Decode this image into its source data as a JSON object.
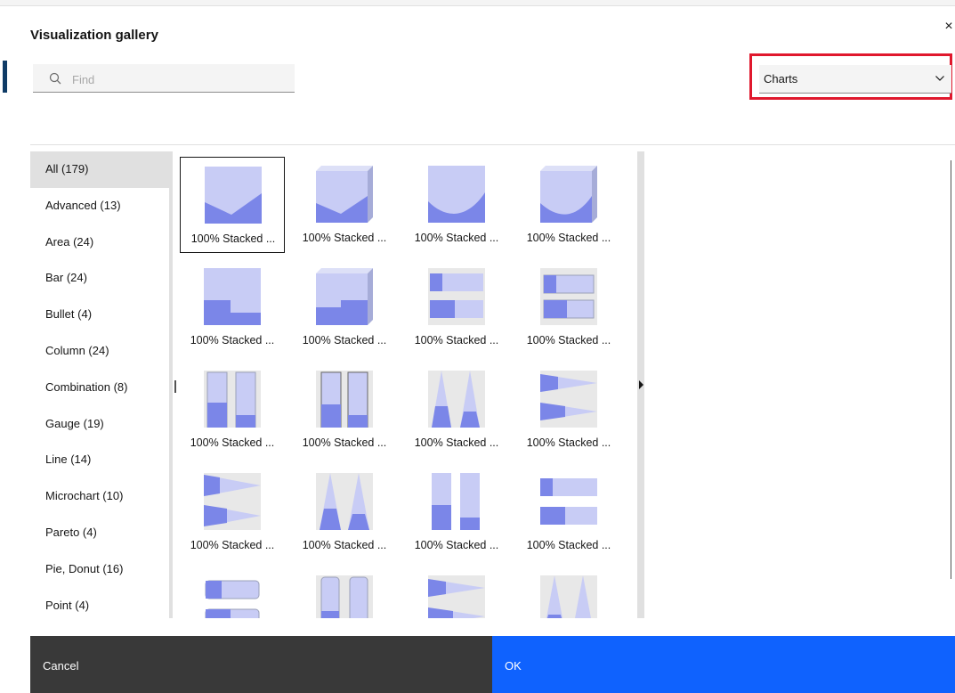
{
  "dialog": {
    "title": "Visualization gallery",
    "close_glyph": "×"
  },
  "search": {
    "placeholder": "Find",
    "value": ""
  },
  "type_select": {
    "value": "Charts"
  },
  "categories": [
    {
      "label": "All (179)",
      "active": true
    },
    {
      "label": "Advanced (13)"
    },
    {
      "label": "Area (24)"
    },
    {
      "label": "Bar (24)"
    },
    {
      "label": "Bullet (4)"
    },
    {
      "label": "Column (24)"
    },
    {
      "label": "Combination (8)"
    },
    {
      "label": "Gauge (19)"
    },
    {
      "label": "Line (14)"
    },
    {
      "label": "Microchart (10)"
    },
    {
      "label": "Pareto (4)"
    },
    {
      "label": "Pie, Donut (16)"
    },
    {
      "label": "Point (4)"
    }
  ],
  "gallery": [
    {
      "label": "100% Stacked ...",
      "icon": "area-stacked-icon",
      "selected": true
    },
    {
      "label": "100% Stacked ...",
      "icon": "area-stacked-3d-icon"
    },
    {
      "label": "100% Stacked ...",
      "icon": "area-smooth-icon"
    },
    {
      "label": "100% Stacked ...",
      "icon": "area-smooth-3d-icon"
    },
    {
      "label": "100% Stacked ...",
      "icon": "area-step-icon"
    },
    {
      "label": "100% Stacked ...",
      "icon": "area-step-3d-icon"
    },
    {
      "label": "100% Stacked ...",
      "icon": "bar-stacked-icon"
    },
    {
      "label": "100% Stacked ...",
      "icon": "bar-stacked-3d-icon"
    },
    {
      "label": "100% Stacked ...",
      "icon": "column-stacked-icon"
    },
    {
      "label": "100% Stacked ...",
      "icon": "column-stacked-3d-icon"
    },
    {
      "label": "100% Stacked ...",
      "icon": "cone-column-icon"
    },
    {
      "label": "100% Stacked ...",
      "icon": "cone-bar-icon"
    },
    {
      "label": "100% Stacked ...",
      "icon": "cone-bar-3d-icon"
    },
    {
      "label": "100% Stacked ...",
      "icon": "cone-column-3d-icon"
    },
    {
      "label": "100% Stacked ...",
      "icon": "cylinder-column-icon"
    },
    {
      "label": "100% Stacked ...",
      "icon": "cylinder-bar-icon"
    },
    {
      "label": "",
      "icon": "cylinder-bar-3d-icon"
    },
    {
      "label": "",
      "icon": "cylinder-column-3d-icon"
    },
    {
      "label": "",
      "icon": "pyramid-bar-icon"
    },
    {
      "label": "",
      "icon": "pyramid-column-icon"
    }
  ],
  "footer": {
    "cancel": "Cancel",
    "ok": "OK"
  },
  "colors": {
    "primary": "#0f62fe",
    "cancel_bg": "#393939",
    "highlight": "#e0182d",
    "chart_fill": "#7b86e8"
  }
}
